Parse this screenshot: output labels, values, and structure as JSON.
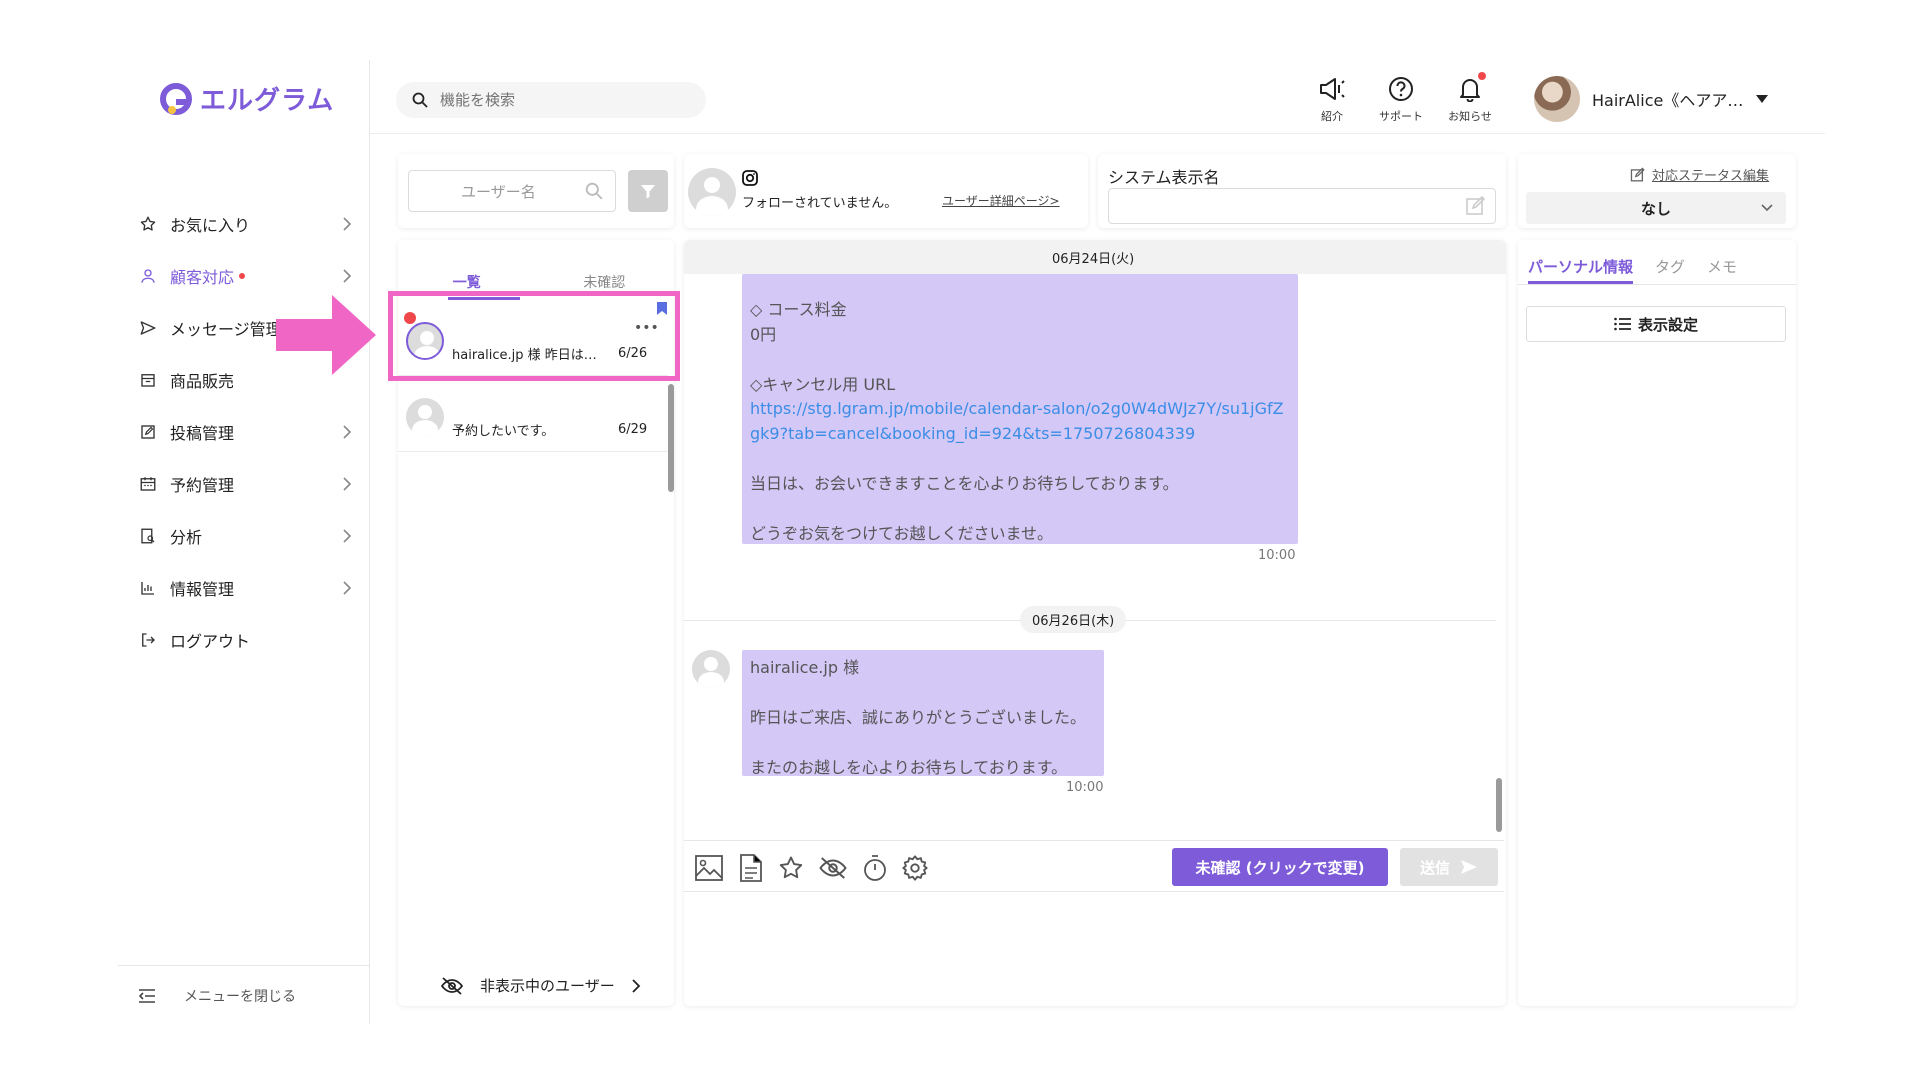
{
  "app": {
    "brand": "エルグラム"
  },
  "sidebar": {
    "items": [
      {
        "label": "お気に入り"
      },
      {
        "label": "顧客対応"
      },
      {
        "label": "メッセージ管理"
      },
      {
        "label": "商品販売"
      },
      {
        "label": "投稿管理"
      },
      {
        "label": "予約管理"
      },
      {
        "label": "分析"
      },
      {
        "label": "情報管理"
      },
      {
        "label": "ログアウト"
      }
    ],
    "close_menu": "メニューを閉じる"
  },
  "header": {
    "search_placeholder": "機能を検索",
    "intro_label": "紹介",
    "support_label": "サポート",
    "notify_label": "お知らせ",
    "user_name": "HairAlice《ヘアア…"
  },
  "users_panel": {
    "filter_placeholder": "ユーザー名",
    "tabs": [
      "一覧",
      "未確認"
    ],
    "conversations": [
      {
        "preview": "hairalice.jp 様 昨日は…",
        "date": "6/26"
      },
      {
        "preview": "予約したいです。",
        "date": "6/29"
      }
    ],
    "hidden_users": "非表示中のユーザー"
  },
  "chat_header": {
    "status": "フォローされていません。",
    "detail_link": "ユーザー詳細ページ>",
    "system_name_label": "システム表示名"
  },
  "chat": {
    "date1": "06月24日(火)",
    "msg1": {
      "line1": "◇ コース料金",
      "line2": "0円",
      "line3": "◇キャンセル用 URL",
      "url": "https://stg.lgram.jp/mobile/calendar-salon/o2g0W4dWJz7Y/su1jGfZgk9?tab=cancel&booking_id=924&ts=1750726804339",
      "line4": "当日は、お会いできますことを心よりお待ちしております。",
      "line5": "どうぞお気をつけてお越しくださいませ。",
      "time": "10:00"
    },
    "date2": "06月26日(木)",
    "msg2": {
      "line1": "hairalice.jp 様",
      "line2": "昨日はご来店、誠にありがとうございました。",
      "line3": "またのお越しを心よりお待ちしております。",
      "time": "10:00"
    },
    "unconfirmed_button": "未確認 (クリックで変更)",
    "send_button": "送信"
  },
  "right_panel": {
    "status_edit": "対応ステータス編集",
    "status_value": "なし",
    "tabs": [
      "パーソナル情報",
      "タグ",
      "メモ"
    ],
    "display_settings": "表示設定"
  },
  "colors": {
    "accent": "#7d5bd9",
    "bubble": "#d4c8f7",
    "highlight": "#f066c4"
  }
}
